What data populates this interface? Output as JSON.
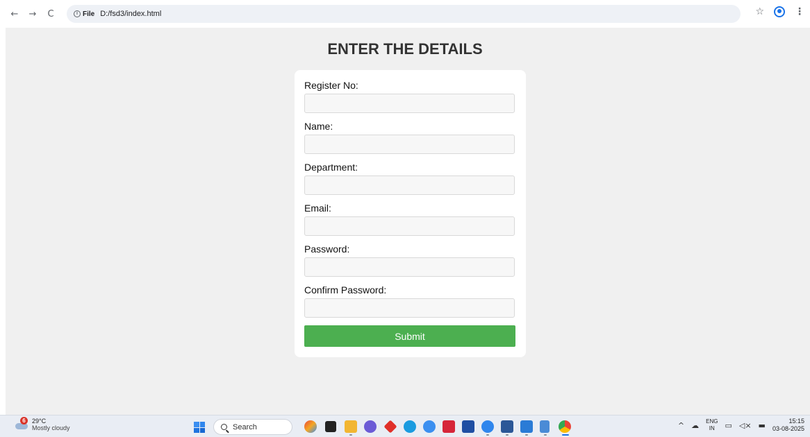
{
  "browser": {
    "back_icon": "←",
    "forward_icon": "→",
    "reload_icon": "C",
    "scheme_label": "File",
    "url": "D:/fsd3/index.html",
    "bookmark_icon": "☆",
    "menu_icon": "⋮"
  },
  "page": {
    "title": "ENTER THE DETAILS",
    "fields": [
      {
        "label": "Register No:",
        "value": ""
      },
      {
        "label": "Name:",
        "value": ""
      },
      {
        "label": "Department:",
        "value": ""
      },
      {
        "label": "Email:",
        "value": ""
      },
      {
        "label": "Password:",
        "value": ""
      },
      {
        "label": "Confirm Password:",
        "value": ""
      }
    ],
    "submit_label": "Submit",
    "colors": {
      "background": "#f0f0f0",
      "card": "#ffffff",
      "submit": "#4caf50",
      "title": "#333333"
    }
  },
  "taskbar": {
    "weather": {
      "badge": "6",
      "temperature": "29°C",
      "condition": "Mostly cloudy"
    },
    "search_label": "Search",
    "tray": {
      "chevron_icon": "^",
      "lang_line1": "ENG",
      "lang_line2": "IN",
      "time": "15:15",
      "date": "03-08-2025"
    }
  }
}
